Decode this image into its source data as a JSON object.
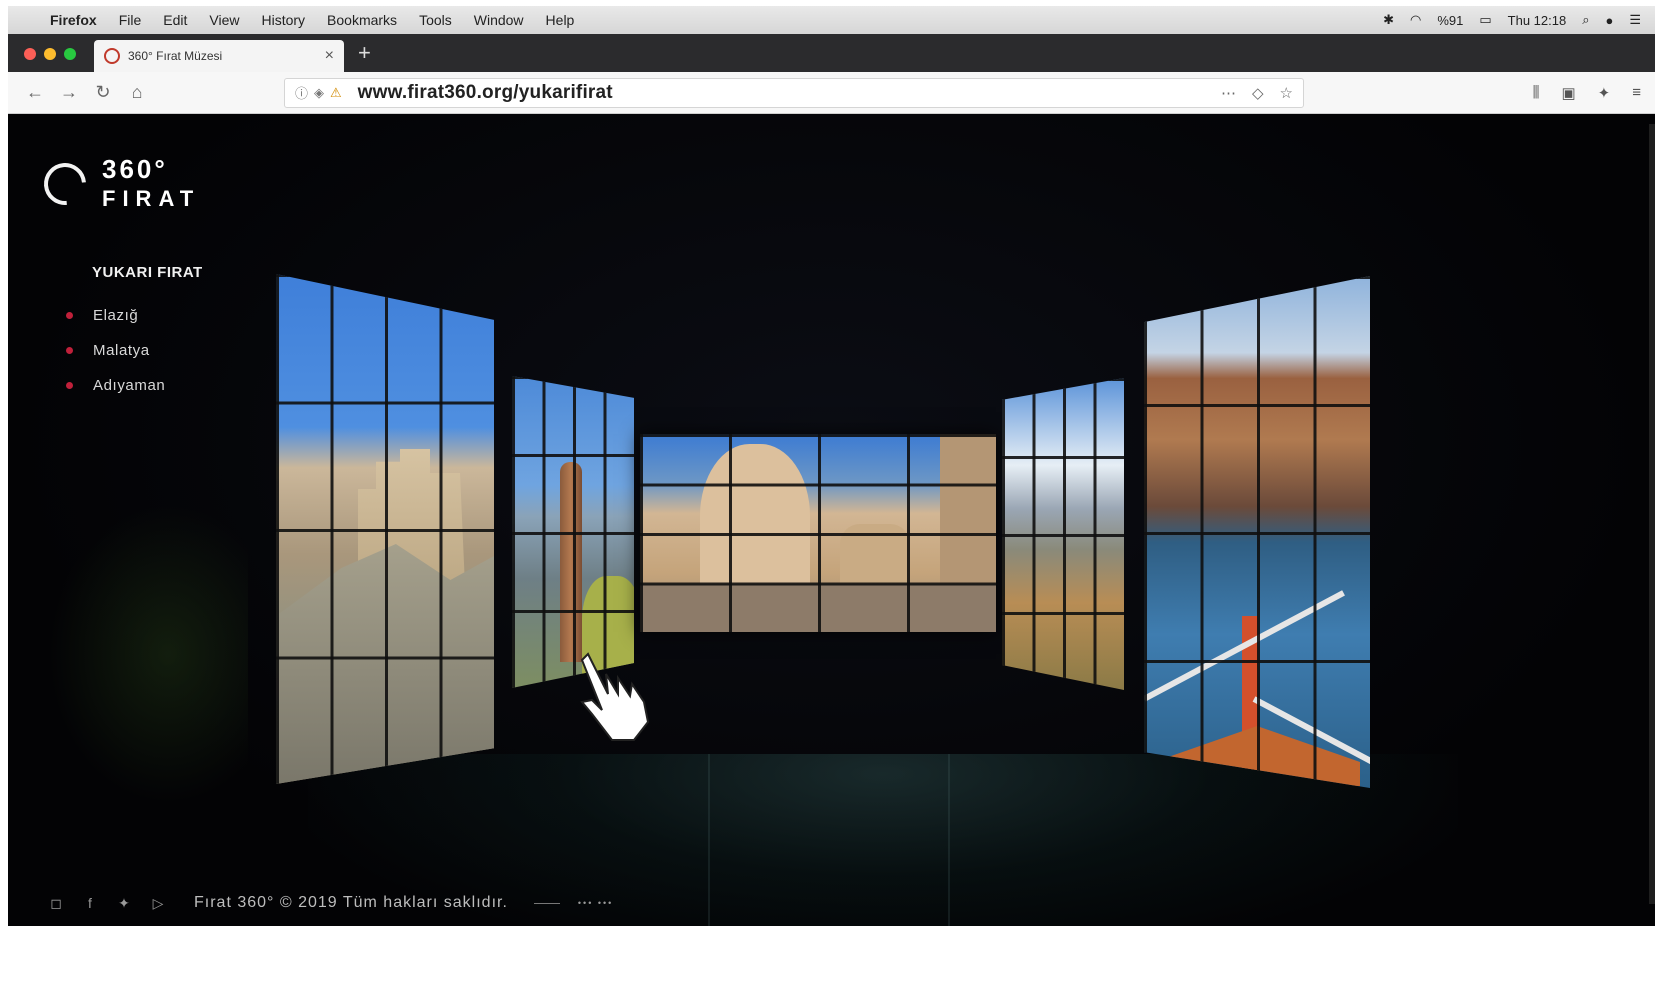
{
  "menubar": {
    "app": "Firefox",
    "items": [
      "File",
      "Edit",
      "View",
      "History",
      "Bookmarks",
      "Tools",
      "Window",
      "Help"
    ],
    "clock": "Thu 12:18",
    "battery_label": "%91"
  },
  "tab": {
    "title": "360° Fırat Müzesi",
    "close": "×",
    "new_tab": "+"
  },
  "address_bar": {
    "url": "www.firat360.org/yukarifirat"
  },
  "page": {
    "logo_top": "360°",
    "logo_bottom": "FIRAT",
    "region_title": "YUKARI FIRAT",
    "regions": [
      "Elazığ",
      "Malatya",
      "Adıyaman"
    ],
    "footer_copyright": "Fırat 360° © 2019 Tüm hakları saklıdır.",
    "footer_credit": "••• •••"
  },
  "colors": {
    "accent_bullet": "#c0203a",
    "background": "#030305"
  },
  "icons": {
    "panels": [
      "castle-photo",
      "rock-pillar-photo",
      "nemrut-statues-photo",
      "canyon-photo",
      "boat-lake-photo"
    ],
    "cursor": "pointing-hand-cursor"
  }
}
